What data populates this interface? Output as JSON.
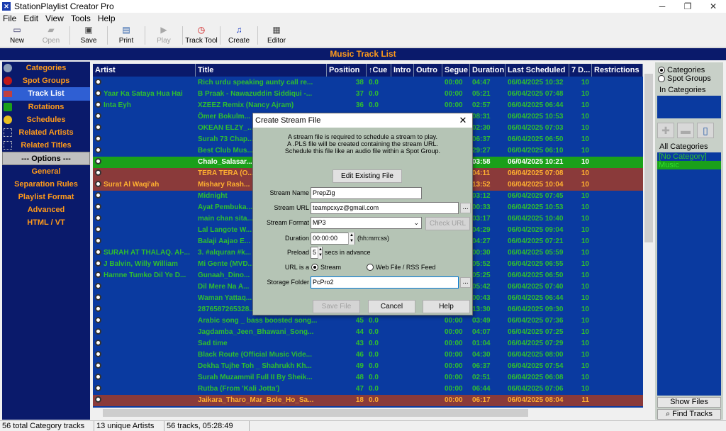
{
  "window": {
    "title": "StationPlaylist Creator Pro",
    "controls": [
      "─",
      "❐",
      "✕"
    ]
  },
  "menu": [
    "File",
    "Edit",
    "View",
    "Tools",
    "Help"
  ],
  "toolbar": [
    {
      "label": "New",
      "icon": "new-doc-icon",
      "enabled": true
    },
    {
      "label": "Open",
      "icon": "open-folder-icon",
      "enabled": false
    },
    {
      "label": "Save",
      "icon": "save-icon",
      "enabled": true
    },
    {
      "label": "Print",
      "icon": "printer-icon",
      "enabled": true
    },
    {
      "label": "Play",
      "icon": "play-icon",
      "enabled": false
    },
    {
      "label": "Track Tool",
      "icon": "clock-icon",
      "enabled": true
    },
    {
      "label": "Create",
      "icon": "music-note-icon",
      "enabled": true
    },
    {
      "label": "Editor",
      "icon": "editor-icon",
      "enabled": true
    }
  ],
  "header": {
    "title": "Music Track List"
  },
  "sidebar": [
    {
      "label": "Categories",
      "type": "item"
    },
    {
      "label": "Spot Groups",
      "type": "item"
    },
    {
      "label": "Track List",
      "type": "selected"
    },
    {
      "label": "Rotations",
      "type": "item"
    },
    {
      "label": "Schedules",
      "type": "item"
    },
    {
      "label": "Related Artists",
      "type": "item"
    },
    {
      "label": "Related Titles",
      "type": "item"
    },
    {
      "label": "--- Options ---",
      "type": "header"
    },
    {
      "label": "General",
      "type": "item"
    },
    {
      "label": "Separation Rules",
      "type": "item"
    },
    {
      "label": "Playlist Format",
      "type": "item"
    },
    {
      "label": "Advanced",
      "type": "item"
    },
    {
      "label": "HTML / VT",
      "type": "item"
    }
  ],
  "table": {
    "columns": [
      "Artist",
      "Title",
      "Position",
      "↑Cue",
      "Intro",
      "Outro",
      "Segue",
      "Duration",
      "Last Scheduled",
      "7 D...",
      "Restrictions"
    ],
    "rows": [
      {
        "artist": "",
        "title": "Rich urdu speaking aunty call re...",
        "position": "38",
        "cue": "0.0",
        "segue": "00:00",
        "duration": "04:47",
        "last": "06/04/2025 10:32",
        "d7": "10",
        "style": ""
      },
      {
        "artist": "Yaar Ka Sataya Hua Hai",
        "title": "B Praak - Nawazuddin Siddiqui -...",
        "position": "37",
        "cue": "0.0",
        "segue": "00:00",
        "duration": "05:21",
        "last": "06/04/2025 07:48",
        "d7": "10",
        "style": ""
      },
      {
        "artist": "Inta Eyh",
        "title": "XZEEZ Remix (Nancy Ajram)",
        "position": "36",
        "cue": "0.0",
        "segue": "00:00",
        "duration": "02:57",
        "last": "06/04/2025 06:44",
        "d7": "10",
        "style": ""
      },
      {
        "artist": "",
        "title": "Ömer Bokulm...",
        "position": "",
        "cue": "",
        "segue": "",
        "duration": "08:31",
        "last": "06/04/2025 10:53",
        "d7": "10",
        "style": ""
      },
      {
        "artist": "",
        "title": "OKEAN ELZY_...",
        "position": "",
        "cue": "",
        "segue": "",
        "duration": "02:30",
        "last": "06/04/2025 07:03",
        "d7": "10",
        "style": ""
      },
      {
        "artist": "",
        "title": "Surah 73 Chap...",
        "position": "",
        "cue": "",
        "segue": "",
        "duration": "06:37",
        "last": "06/04/2025 06:50",
        "d7": "10",
        "style": ""
      },
      {
        "artist": "",
        "title": "Best Club Mus...",
        "position": "",
        "cue": "",
        "segue": "",
        "duration": "29:27",
        "last": "06/04/2025 06:10",
        "d7": "10",
        "style": ""
      },
      {
        "artist": "",
        "title": "Chalo_Salasar...",
        "position": "",
        "cue": "",
        "segue": "",
        "duration": "03:58",
        "last": "06/04/2025 10:21",
        "d7": "10",
        "style": "green"
      },
      {
        "artist": "",
        "title": "TERA TERA (O...",
        "position": "",
        "cue": "",
        "segue": "",
        "duration": "04:11",
        "last": "06/04/2025 07:08",
        "d7": "10",
        "style": "red"
      },
      {
        "artist": "Surat Al Waqi'ah",
        "title": "Mishary Rash...",
        "position": "",
        "cue": "",
        "segue": "",
        "duration": "13:52",
        "last": "06/04/2025 10:04",
        "d7": "10",
        "style": "red"
      },
      {
        "artist": "",
        "title": "Midnight",
        "position": "",
        "cue": "",
        "segue": "",
        "duration": "03:12",
        "last": "06/04/2025 07:45",
        "d7": "10",
        "style": ""
      },
      {
        "artist": "",
        "title": "Ayat Pembuka...",
        "position": "",
        "cue": "",
        "segue": "",
        "duration": "00:33",
        "last": "06/04/2025 10:53",
        "d7": "10",
        "style": ""
      },
      {
        "artist": "",
        "title": "main chan sita...",
        "position": "",
        "cue": "",
        "segue": "",
        "duration": "03:17",
        "last": "06/04/2025 10:40",
        "d7": "10",
        "style": ""
      },
      {
        "artist": "",
        "title": "Lal Langote W...",
        "position": "",
        "cue": "",
        "segue": "",
        "duration": "04:29",
        "last": "06/04/2025 09:04",
        "d7": "10",
        "style": ""
      },
      {
        "artist": "",
        "title": "Balaji Aajao E...",
        "position": "",
        "cue": "",
        "segue": "",
        "duration": "04:27",
        "last": "06/04/2025 07:21",
        "d7": "10",
        "style": ""
      },
      {
        "artist": "SURAH AT THALAQ. Al-...",
        "title": "3. #alquran #k...",
        "position": "",
        "cue": "",
        "segue": "",
        "duration": "00:30",
        "last": "06/04/2025 05:59",
        "d7": "10",
        "style": ""
      },
      {
        "artist": "J Balvin, Willy William",
        "title": "Mi Gente (MVD...",
        "position": "",
        "cue": "",
        "segue": "",
        "duration": "05:52",
        "last": "06/04/2025 06:55",
        "d7": "10",
        "style": ""
      },
      {
        "artist": "Hamne Tumko Dil Ye D...",
        "title": "Gunaah_Dino...",
        "position": "",
        "cue": "",
        "segue": "",
        "duration": "05:25",
        "last": "06/04/2025 06:50",
        "d7": "10",
        "style": ""
      },
      {
        "artist": "",
        "title": "Dil Mere Na A...",
        "position": "",
        "cue": "",
        "segue": "",
        "duration": "05:42",
        "last": "06/04/2025 07:40",
        "d7": "10",
        "style": ""
      },
      {
        "artist": "",
        "title": "Waman Yattaq...",
        "position": "",
        "cue": "",
        "segue": "",
        "duration": "00:43",
        "last": "06/04/2025 06:44",
        "d7": "10",
        "style": ""
      },
      {
        "artist": "",
        "title": "2876587265328...",
        "position": "",
        "cue": "",
        "segue": "",
        "duration": "13:30",
        "last": "06/04/2025 09:30",
        "d7": "10",
        "style": ""
      },
      {
        "artist": "",
        "title": "Arabic song _ bass boosted song...",
        "position": "45",
        "cue": "0.0",
        "segue": "00:00",
        "duration": "03:49",
        "last": "06/04/2025 07:36",
        "d7": "10",
        "style": ""
      },
      {
        "artist": "",
        "title": "Jagdamba_Jeen_Bhawani_Song...",
        "position": "44",
        "cue": "0.0",
        "segue": "00:00",
        "duration": "04:07",
        "last": "06/04/2025 07:25",
        "d7": "10",
        "style": ""
      },
      {
        "artist": "",
        "title": "Sad time",
        "position": "43",
        "cue": "0.0",
        "segue": "00:00",
        "duration": "01:04",
        "last": "06/04/2025 07:29",
        "d7": "10",
        "style": ""
      },
      {
        "artist": "",
        "title": "Black Route  (Official Music Vide...",
        "position": "46",
        "cue": "0.0",
        "segue": "00:00",
        "duration": "04:30",
        "last": "06/04/2025 08:00",
        "d7": "10",
        "style": ""
      },
      {
        "artist": "",
        "title": "Dekha Tujhe Toh _ Shahrukh Kh...",
        "position": "49",
        "cue": "0.0",
        "segue": "00:00",
        "duration": "06:37",
        "last": "06/04/2025 07:54",
        "d7": "10",
        "style": ""
      },
      {
        "artist": "",
        "title": "Surah Muzammil Full II By Sheik...",
        "position": "48",
        "cue": "0.0",
        "segue": "00:00",
        "duration": "02:51",
        "last": "06/04/2025 06:08",
        "d7": "10",
        "style": ""
      },
      {
        "artist": "",
        "title": "Rutba (From 'Kali Jotta')",
        "position": "47",
        "cue": "0.0",
        "segue": "00:00",
        "duration": "06:44",
        "last": "06/04/2025 07:06",
        "d7": "10",
        "style": ""
      },
      {
        "artist": "",
        "title": "Jaikara_Tharo_Mar_Bole_Ho_Sa...",
        "position": "18",
        "cue": "0.0",
        "segue": "00:00",
        "duration": "06:17",
        "last": "06/04/2025 08:04",
        "d7": "11",
        "style": "red"
      }
    ]
  },
  "right_panel": {
    "radio_categories": "Categories",
    "radio_spot": "Spot Groups",
    "in_categories": "In Categories",
    "all_categories": "All Categories",
    "categories": [
      "[No Category]",
      "Music"
    ],
    "show_files": "Show Files",
    "find_tracks": "Find Tracks"
  },
  "status": [
    "56 total Category tracks",
    "13 unique Artists",
    "56 tracks, 05:28:49"
  ],
  "dialog": {
    "title": "Create Stream File",
    "info1": "A stream file is required to schedule a stream to play.",
    "info2": "A .PLS file will be created containing the stream URL.",
    "info3": "Schedule this file like an audio file within a Spot Group.",
    "edit_existing": "Edit Existing File",
    "stream_name_label": "Stream Name",
    "stream_name": "PrepZig",
    "stream_url_label": "Stream URL",
    "stream_url": "teampcxyz@gmail.com",
    "stream_format_label": "Stream Format",
    "stream_format": "MP3",
    "check_url": "Check URL",
    "duration_label": "Duration",
    "duration": "00:00:00",
    "duration_hint": "(hh:mm:ss)",
    "preload_label": "Preload",
    "preload": "5",
    "preload_hint": "secs in advance",
    "url_is_label": "URL is a",
    "opt_stream": "Stream",
    "opt_web": "Web File / RSS Feed",
    "storage_label": "Storage Folder",
    "storage": "PcPro2",
    "ellipsis": "...",
    "save": "Save File",
    "cancel": "Cancel",
    "help": "Help"
  }
}
